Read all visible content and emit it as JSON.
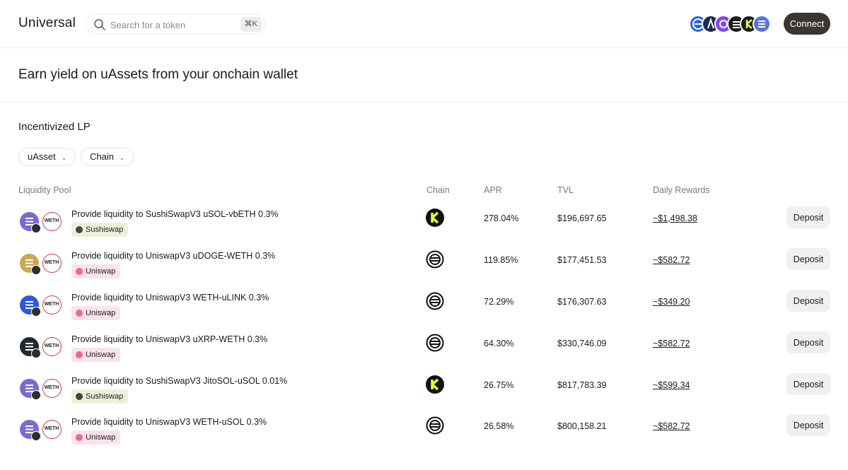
{
  "header": {
    "logo": "Universal",
    "search_placeholder": "Search for a token",
    "search_shortcut": "⌘K",
    "connect_label": "Connect",
    "chain_icons": [
      "ethereum-icon",
      "arbitrum-icon",
      "polygon-icon",
      "base-icon",
      "kaia-icon",
      "solana-icon"
    ]
  },
  "hero": {
    "title": "Earn yield on uAssets from your onchain wallet"
  },
  "section": {
    "title": "Incentivized LP",
    "filters": {
      "uasset": "uAsset",
      "chain": "Chain"
    },
    "columns": {
      "pool": "Liquidity Pool",
      "chain": "Chain",
      "apr": "APR",
      "tvl": "TVL",
      "rewards": "Daily Rewards"
    }
  },
  "pools": [
    {
      "name": "Provide liquidity to SushiSwapV3 uSOL-vbETH 0.3%",
      "dex": "Sushiswap",
      "token_icon": "solana-icon",
      "token_color": "#7b6ad0",
      "chain_icon": "kaia-icon",
      "apr": "278.04%",
      "tvl": "$196,697.65",
      "rewards": "~$1,498.38",
      "action": "Deposit"
    },
    {
      "name": "Provide liquidity to UniswapV3 uDOGE-WETH 0.3%",
      "dex": "Uniswap",
      "token_icon": "dogecoin-icon",
      "token_color": "#c9a94a",
      "chain_icon": "ethereum-icon",
      "apr": "119.85%",
      "tvl": "$177,451.53",
      "rewards": "~$582.72",
      "action": "Deposit"
    },
    {
      "name": "Provide liquidity to UniswapV3 WETH-uLINK 0.3%",
      "dex": "Uniswap",
      "token_icon": "chainlink-icon",
      "token_color": "#2a5ada",
      "chain_icon": "ethereum-icon",
      "apr": "72.29%",
      "tvl": "$176,307.63",
      "rewards": "~$349.20",
      "action": "Deposit"
    },
    {
      "name": "Provide liquidity to UniswapV3 uXRP-WETH 0.3%",
      "dex": "Uniswap",
      "token_icon": "xrp-icon",
      "token_color": "#23292f",
      "chain_icon": "ethereum-icon",
      "apr": "64.30%",
      "tvl": "$330,746.09",
      "rewards": "~$582.72",
      "action": "Deposit"
    },
    {
      "name": "Provide liquidity to SushiSwapV3 JitoSOL-uSOL 0.01%",
      "dex": "Sushiswap",
      "token_icon": "solana-icon",
      "token_color": "#7b6ad0",
      "chain_icon": "kaia-icon",
      "apr": "26.75%",
      "tvl": "$817,783.39",
      "rewards": "~$599.34",
      "action": "Deposit"
    },
    {
      "name": "Provide liquidity to UniswapV3 WETH-uSOL 0.3%",
      "dex": "Uniswap",
      "token_icon": "solana-icon",
      "token_color": "#7b6ad0",
      "chain_icon": "ethereum-icon",
      "apr": "26.58%",
      "tvl": "$800,158.21",
      "rewards": "~$582.72",
      "action": "Deposit"
    }
  ]
}
